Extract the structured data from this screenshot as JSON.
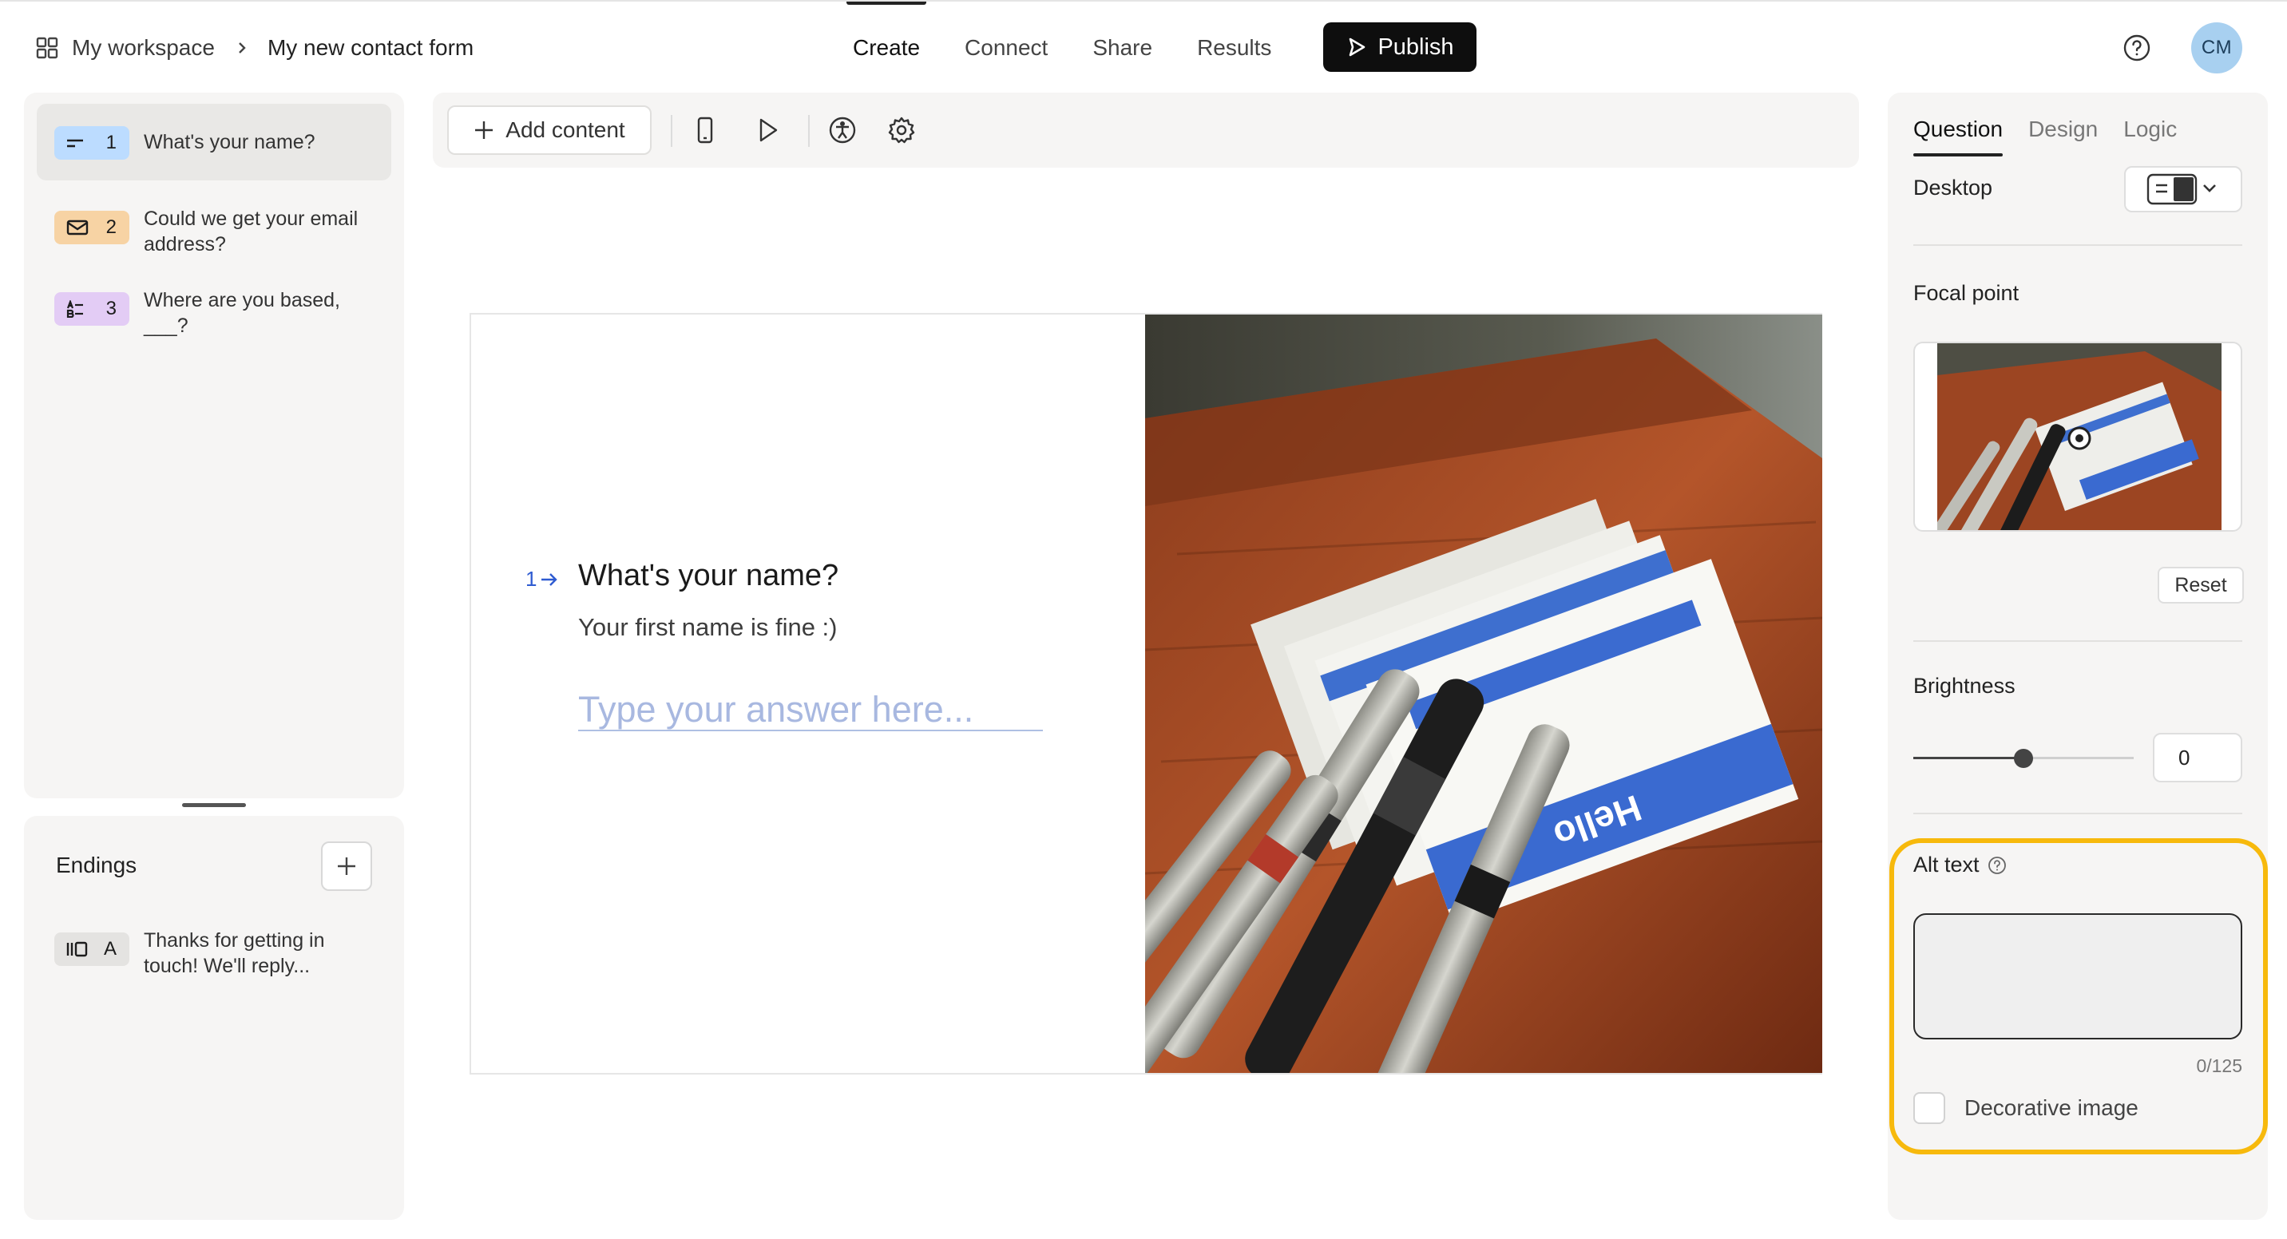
{
  "header": {
    "breadcrumb_workspace": "My workspace",
    "breadcrumb_form": "My new contact form",
    "tabs": [
      {
        "label": "Create",
        "active": true
      },
      {
        "label": "Connect",
        "active": false
      },
      {
        "label": "Share",
        "active": false
      },
      {
        "label": "Results",
        "active": false
      }
    ],
    "publish_label": "Publish",
    "avatar_initials": "CM"
  },
  "questions": [
    {
      "number": "1",
      "text": "What's your name?",
      "icon": "short-text-icon",
      "badge_color": "#bcdcff",
      "selected": true
    },
    {
      "number": "2",
      "text": "Could we get your email address?",
      "icon": "mail-icon",
      "badge_color": "#f7d3a4",
      "selected": false
    },
    {
      "number": "3",
      "text": "Where are you based, ___?",
      "icon": "multiple-choice-icon",
      "badge_color": "#e3ccf5",
      "selected": false
    }
  ],
  "endings": {
    "title": "Endings",
    "items": [
      {
        "letter": "A",
        "text": "Thanks for getting in touch! We'll reply...",
        "icon": "ending-icon",
        "badge_color": "#e4e3e1"
      }
    ]
  },
  "toolbar": {
    "add_content_label": "Add content"
  },
  "canvas": {
    "question_number": "1",
    "question_title": "What's your name?",
    "question_description": "Your first name is fine :)",
    "answer_placeholder": "Type your answer here...",
    "image_text": "Hello"
  },
  "panel": {
    "tabs": [
      {
        "label": "Question",
        "active": true
      },
      {
        "label": "Design",
        "active": false
      },
      {
        "label": "Logic",
        "active": false
      }
    ],
    "device_label": "Desktop",
    "focal_point_label": "Focal point",
    "reset_label": "Reset",
    "brightness_label": "Brightness",
    "brightness_value": "0",
    "brightness_fraction": 0.5,
    "alt_text_label": "Alt text",
    "alt_text_value": "",
    "alt_text_counter": "0/125",
    "decorative_label": "Decorative image",
    "decorative_checked": false
  },
  "colors": {
    "accent_blue": "#2e5bd1",
    "highlight": "#f7b90c",
    "publish_bg": "#0e0e0e"
  }
}
